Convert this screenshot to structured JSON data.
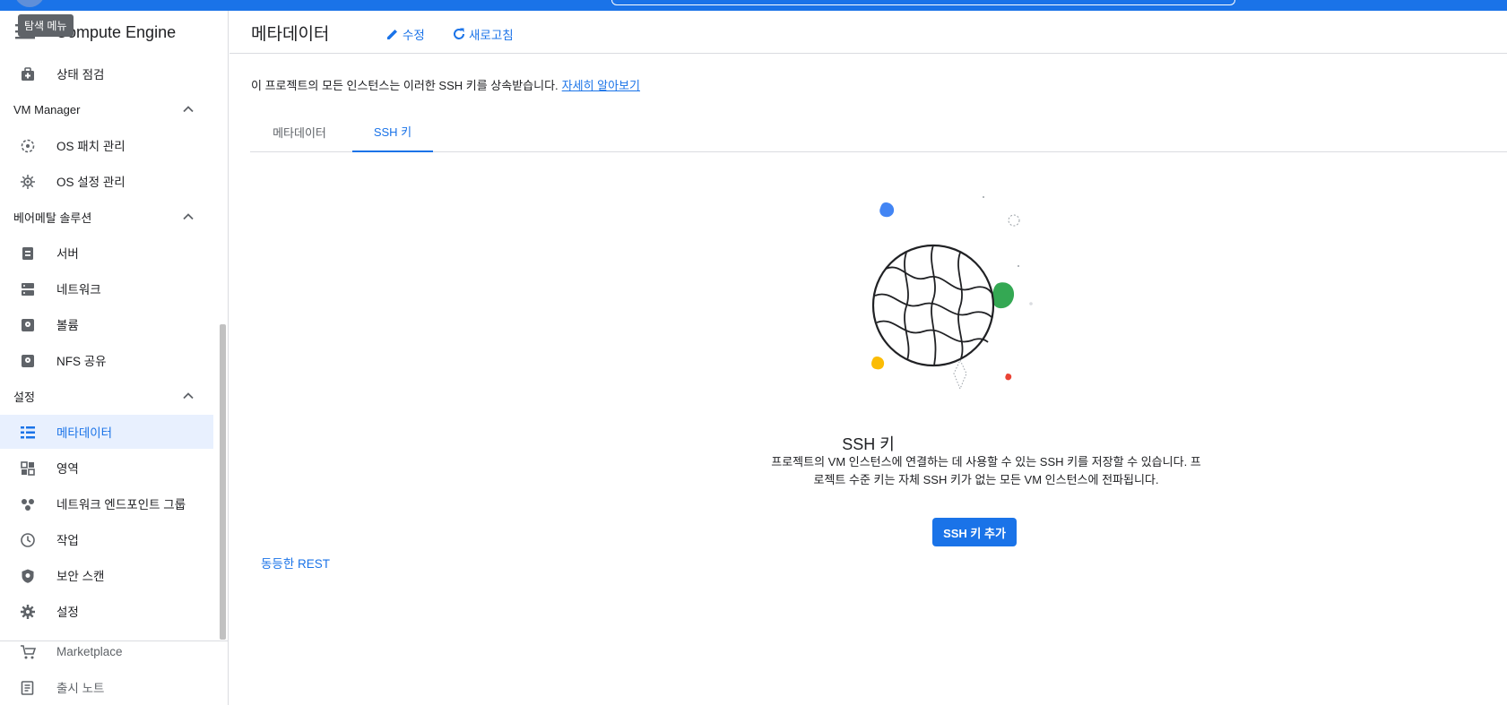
{
  "topbar": {
    "tooltip": "탐색 메뉴"
  },
  "sidebar": {
    "product": "Compute Engine",
    "items": [
      {
        "label": "상태 점검",
        "icon": "health-check-icon"
      },
      {
        "section": "VM Manager"
      },
      {
        "label": "OS 패치 관리",
        "icon": "os-patch-icon"
      },
      {
        "label": "OS 설정 관리",
        "icon": "os-config-icon"
      },
      {
        "section": "베어메탈 솔루션"
      },
      {
        "label": "서버",
        "icon": "server-icon"
      },
      {
        "label": "네트워크",
        "icon": "network-icon"
      },
      {
        "label": "볼륨",
        "icon": "volume-icon"
      },
      {
        "label": "NFS 공유",
        "icon": "nfs-share-icon"
      },
      {
        "section": "설정"
      },
      {
        "label": "메타데이터",
        "icon": "metadata-icon",
        "active": true
      },
      {
        "label": "영역",
        "icon": "zones-icon"
      },
      {
        "label": "네트워크 엔드포인트 그룹",
        "icon": "network-endpoint-group-icon"
      },
      {
        "label": "작업",
        "icon": "operations-icon"
      },
      {
        "label": "보안 스캔",
        "icon": "security-scan-icon"
      },
      {
        "label": "설정",
        "icon": "settings-gear-icon"
      }
    ],
    "marketplace": "Marketplace",
    "release_notes": "출시 노트"
  },
  "header": {
    "title": "메타데이터",
    "edit_label": "수정",
    "refresh_label": "새로고침"
  },
  "description": {
    "text": "이 프로젝트의 모든 인스턴스는 이러한 SSH 키를 상속받습니다.",
    "link": "자세히 알아보기"
  },
  "tabs": [
    {
      "label": "메타데이터",
      "active": false
    },
    {
      "label": "SSH 키",
      "active": true
    }
  ],
  "empty_state": {
    "title": "SSH 키",
    "description": "프로젝트의 VM 인스턴스에 연결하는 데 사용할 수 있는 SSH 키를 저장할 수 있습니다. 프로젝트 수준 키는 자체 SSH 키가 없는 모든 VM 인스턴스에 전파됩니다.",
    "button": "SSH 키 추가"
  },
  "rest_link": "동등한 REST",
  "colors": {
    "accent": "#1a73e8",
    "active_bg": "#e8f0fe",
    "blob_blue": "#4285f4",
    "blob_green": "#34a853",
    "blob_yellow": "#fbbc04",
    "blob_red": "#ea4335"
  }
}
